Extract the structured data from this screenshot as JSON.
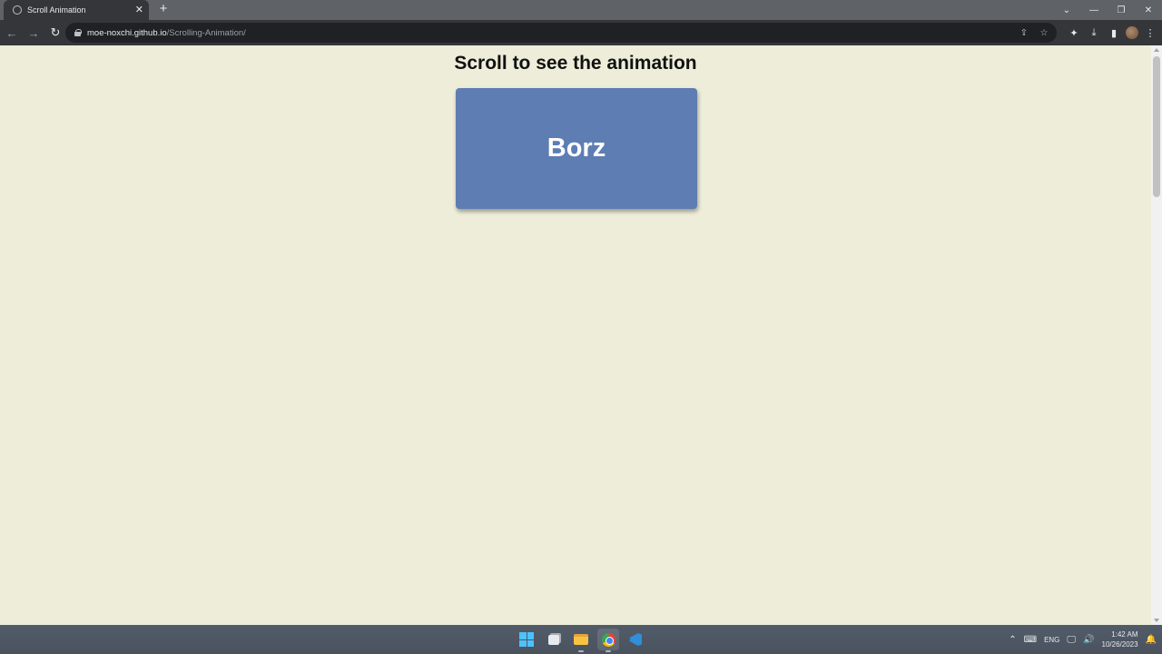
{
  "browser": {
    "tab_title": "Scroll Animation",
    "tab_close": "✕",
    "new_tab": "+",
    "url_host": "moe-noxchi.github.io",
    "url_path": "/Scrolling-Animation/"
  },
  "page": {
    "heading": "Scroll to see the animation",
    "box_label": "Borz",
    "background_color": "#ededd9",
    "box_color": "#5d7db3"
  },
  "taskbar": {
    "language": "ENG",
    "time": "1:42 AM",
    "date": "10/26/2023"
  }
}
